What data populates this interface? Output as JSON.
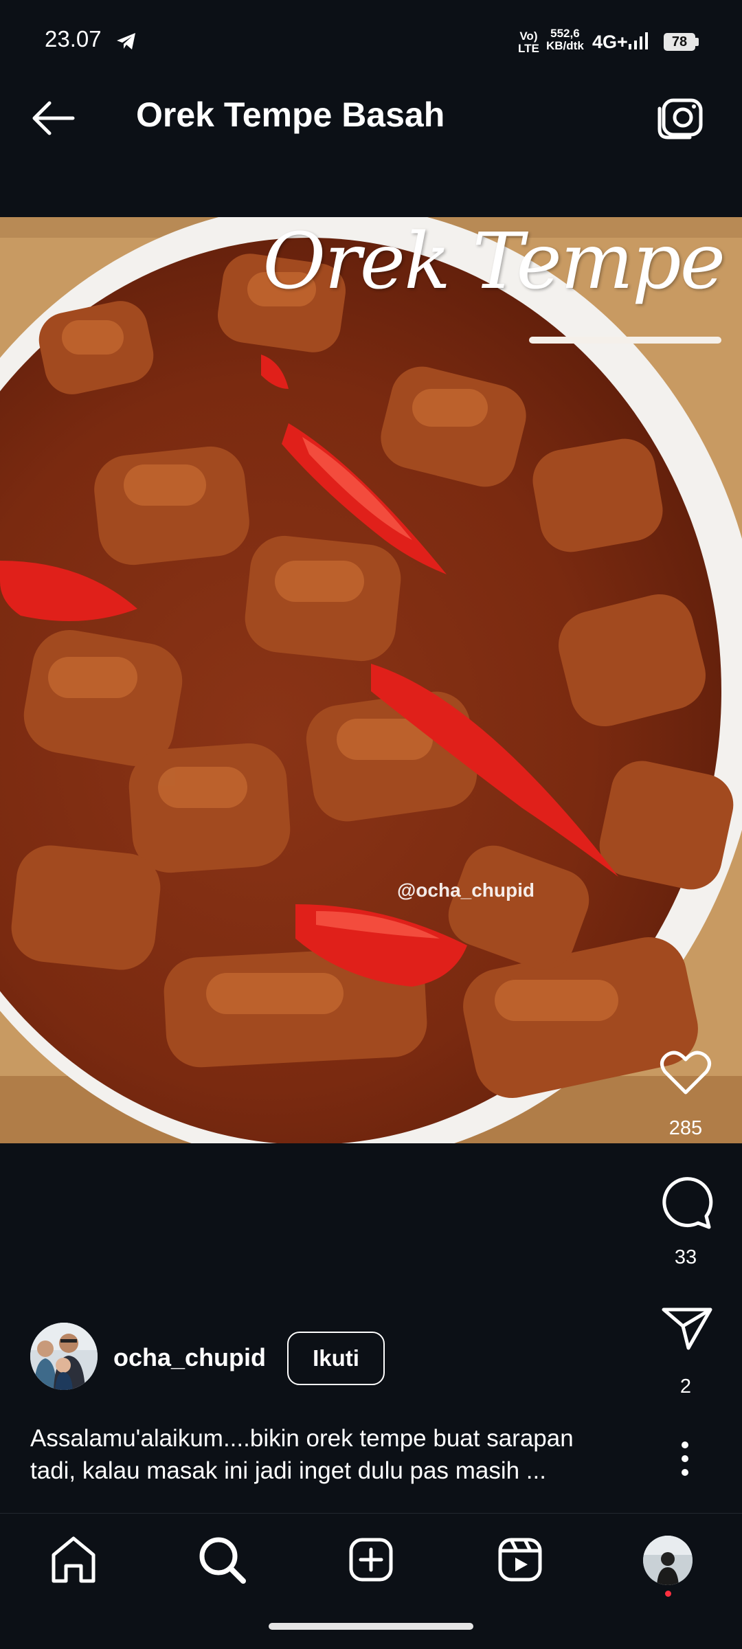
{
  "status_bar": {
    "time": "23.07",
    "volte_top": "Vo)",
    "volte_bottom": "LTE",
    "speed_value": "552,6",
    "speed_unit": "KB/dtk",
    "network": "4G+",
    "battery": "78",
    "icons": [
      "telegram-icon",
      "signal-icon",
      "battery-icon"
    ]
  },
  "header": {
    "title": "Orek Tempe Basah",
    "back_icon": "arrow-left-icon",
    "camera_icon": "camera-icon"
  },
  "photo": {
    "overlay_title": "Orek Tempe",
    "watermark": "@ocha_chupid"
  },
  "actions": {
    "likes": "285",
    "comments": "33",
    "shares": "2",
    "icons": [
      "heart-icon",
      "comment-icon",
      "send-icon",
      "more-vertical-icon"
    ]
  },
  "post": {
    "username": "ocha_chupid",
    "follow_label": "Ikuti",
    "caption_line1": "Assalamu'alaikum....bikin orek tempe buat sarapan",
    "caption_line2": "tadi, kalau masak ini jadi inget dulu pas masih ..."
  },
  "bottom_nav": {
    "items": [
      "home-icon",
      "search-icon",
      "add-post-icon",
      "reels-icon",
      "profile-avatar"
    ]
  },
  "colors": {
    "background": "#0c1016",
    "notification_dot": "#ff3040",
    "text": "#ffffff"
  }
}
